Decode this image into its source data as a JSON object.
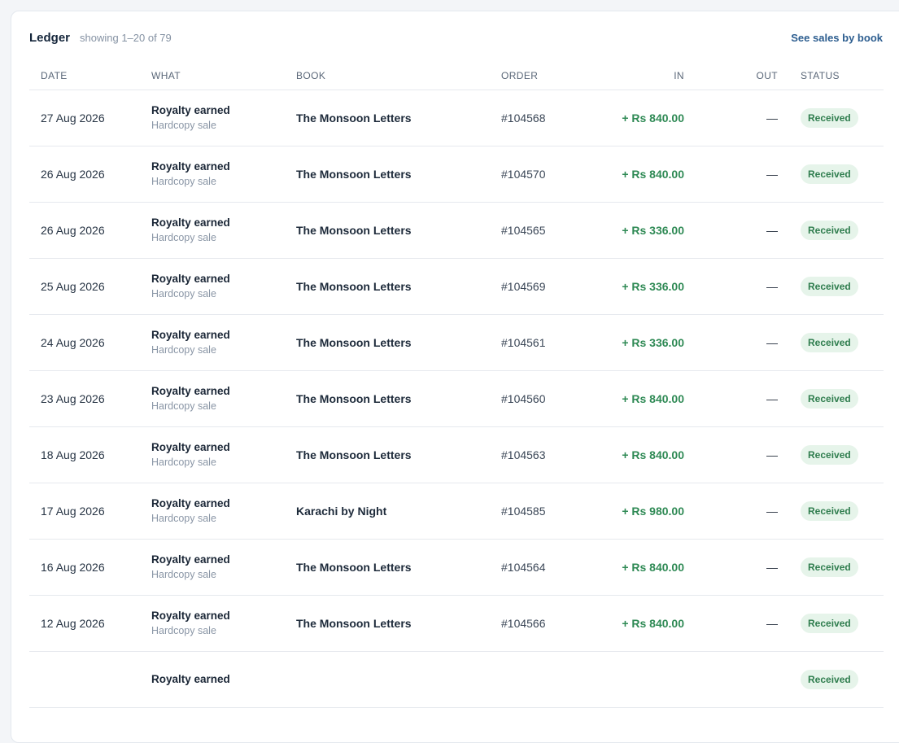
{
  "ledger": {
    "title": "Ledger",
    "subtitle": "showing 1–20 of 79",
    "link_label": "See sales by book"
  },
  "columns": {
    "date": "DATE",
    "what": "WHAT",
    "book": "BOOK",
    "order": "ORDER",
    "in": "IN",
    "out": "OUT",
    "status": "STATUS"
  },
  "rows": [
    {
      "date": "27 Aug 2026",
      "what": "Royalty earned",
      "what_sub": "Hardcopy sale",
      "book": "The Monsoon Letters",
      "order": "#104568",
      "in": "+ Rs 840.00",
      "out": "—",
      "status": "Received"
    },
    {
      "date": "26 Aug 2026",
      "what": "Royalty earned",
      "what_sub": "Hardcopy sale",
      "book": "The Monsoon Letters",
      "order": "#104570",
      "in": "+ Rs 840.00",
      "out": "—",
      "status": "Received"
    },
    {
      "date": "26 Aug 2026",
      "what": "Royalty earned",
      "what_sub": "Hardcopy sale",
      "book": "The Monsoon Letters",
      "order": "#104565",
      "in": "+ Rs 336.00",
      "out": "—",
      "status": "Received"
    },
    {
      "date": "25 Aug 2026",
      "what": "Royalty earned",
      "what_sub": "Hardcopy sale",
      "book": "The Monsoon Letters",
      "order": "#104569",
      "in": "+ Rs 336.00",
      "out": "—",
      "status": "Received"
    },
    {
      "date": "24 Aug 2026",
      "what": "Royalty earned",
      "what_sub": "Hardcopy sale",
      "book": "The Monsoon Letters",
      "order": "#104561",
      "in": "+ Rs 336.00",
      "out": "—",
      "status": "Received"
    },
    {
      "date": "23 Aug 2026",
      "what": "Royalty earned",
      "what_sub": "Hardcopy sale",
      "book": "The Monsoon Letters",
      "order": "#104560",
      "in": "+ Rs 840.00",
      "out": "—",
      "status": "Received"
    },
    {
      "date": "18 Aug 2026",
      "what": "Royalty earned",
      "what_sub": "Hardcopy sale",
      "book": "The Monsoon Letters",
      "order": "#104563",
      "in": "+ Rs 840.00",
      "out": "—",
      "status": "Received"
    },
    {
      "date": "17 Aug 2026",
      "what": "Royalty earned",
      "what_sub": "Hardcopy sale",
      "book": "Karachi by Night",
      "order": "#104585",
      "in": "+ Rs 980.00",
      "out": "—",
      "status": "Received"
    },
    {
      "date": "16 Aug 2026",
      "what": "Royalty earned",
      "what_sub": "Hardcopy sale",
      "book": "The Monsoon Letters",
      "order": "#104564",
      "in": "+ Rs 840.00",
      "out": "—",
      "status": "Received"
    },
    {
      "date": "12 Aug 2026",
      "what": "Royalty earned",
      "what_sub": "Hardcopy sale",
      "book": "The Monsoon Letters",
      "order": "#104566",
      "in": "+ Rs 840.00",
      "out": "—",
      "status": "Received"
    },
    {
      "date": "",
      "what": "Royalty earned",
      "what_sub": "",
      "book": "",
      "order": "",
      "in": "",
      "out": "",
      "status": "Received"
    }
  ],
  "colors": {
    "in_amount": "#2f8a55",
    "badge_bg": "#e6f4ea",
    "badge_text": "#2f7d4e",
    "link": "#2c5d8f"
  }
}
